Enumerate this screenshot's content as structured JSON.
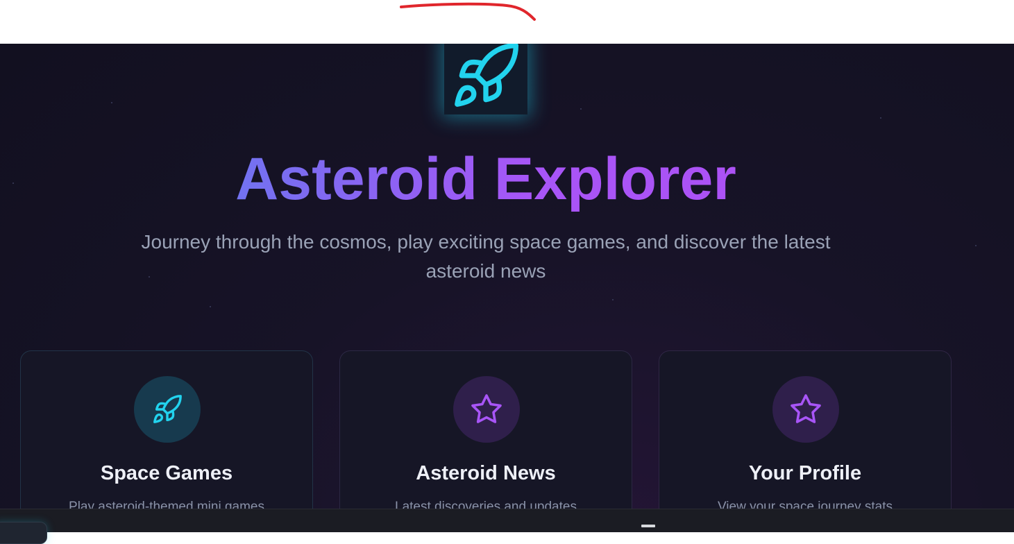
{
  "hero": {
    "logo_icon": "rocket-icon",
    "title": "Asteroid Explorer",
    "subtitle": "Journey through the cosmos, play exciting space games, and discover the latest asteroid news"
  },
  "cards": [
    {
      "icon": "rocket-icon",
      "title": "Space Games",
      "description": "Play asteroid-themed mini games"
    },
    {
      "icon": "star-icon",
      "title": "Asteroid News",
      "description": "Latest discoveries and updates"
    },
    {
      "icon": "star-icon",
      "title": "Your Profile",
      "description": "View your space journey stats"
    }
  ],
  "colors": {
    "accent_cyan": "#22d3ee",
    "accent_purple": "#a855f7",
    "background": "#171327",
    "annotation_red": "#e0262c"
  }
}
